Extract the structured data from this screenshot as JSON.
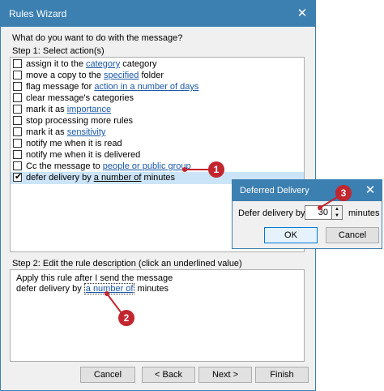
{
  "wizard": {
    "title": "Rules Wizard",
    "question": "What do you want to do with the message?",
    "step1_label": "Step 1: Select action(s)",
    "step2_label": "Step 2: Edit the rule description (click an underlined value)",
    "actions": [
      {
        "pre": "assign it to the ",
        "link": "category",
        "post": " category",
        "checked": false
      },
      {
        "pre": "move a copy to the ",
        "link": "specified",
        "post": " folder",
        "checked": false
      },
      {
        "pre": "flag message for ",
        "link": "action in a number of days",
        "post": "",
        "checked": false
      },
      {
        "pre": "clear message's categories",
        "link": "",
        "post": "",
        "checked": false
      },
      {
        "pre": "mark it as ",
        "link": "importance",
        "post": "",
        "checked": false
      },
      {
        "pre": "stop processing more rules",
        "link": "",
        "post": "",
        "checked": false
      },
      {
        "pre": "mark it as ",
        "link": "sensitivity",
        "post": "",
        "checked": false
      },
      {
        "pre": "notify me when it is read",
        "link": "",
        "post": "",
        "checked": false
      },
      {
        "pre": "notify me when it is delivered",
        "link": "",
        "post": "",
        "checked": false
      },
      {
        "pre": "Cc the message to ",
        "link": "people or public group",
        "post": "",
        "checked": false
      },
      {
        "pre": "defer delivery by ",
        "link": "a number of",
        "post": " minutes",
        "checked": true
      }
    ],
    "description": {
      "line1": "Apply this rule after I send the message",
      "line2_pre": "defer delivery by ",
      "line2_link": "a number of",
      "line2_post": " minutes"
    },
    "buttons": {
      "cancel": "Cancel",
      "back": "< Back",
      "next": "Next >",
      "finish": "Finish"
    }
  },
  "deferred_dialog": {
    "title": "Deferred Delivery",
    "label": "Defer delivery by",
    "value": "30",
    "units": "minutes",
    "ok": "OK",
    "cancel": "Cancel"
  },
  "callouts": {
    "one": "1",
    "two": "2",
    "three": "3",
    "color": "#c2262e"
  },
  "colors": {
    "title_bar": "#3c7fb1",
    "selection": "#cce4f7",
    "link": "#1a58a8"
  }
}
